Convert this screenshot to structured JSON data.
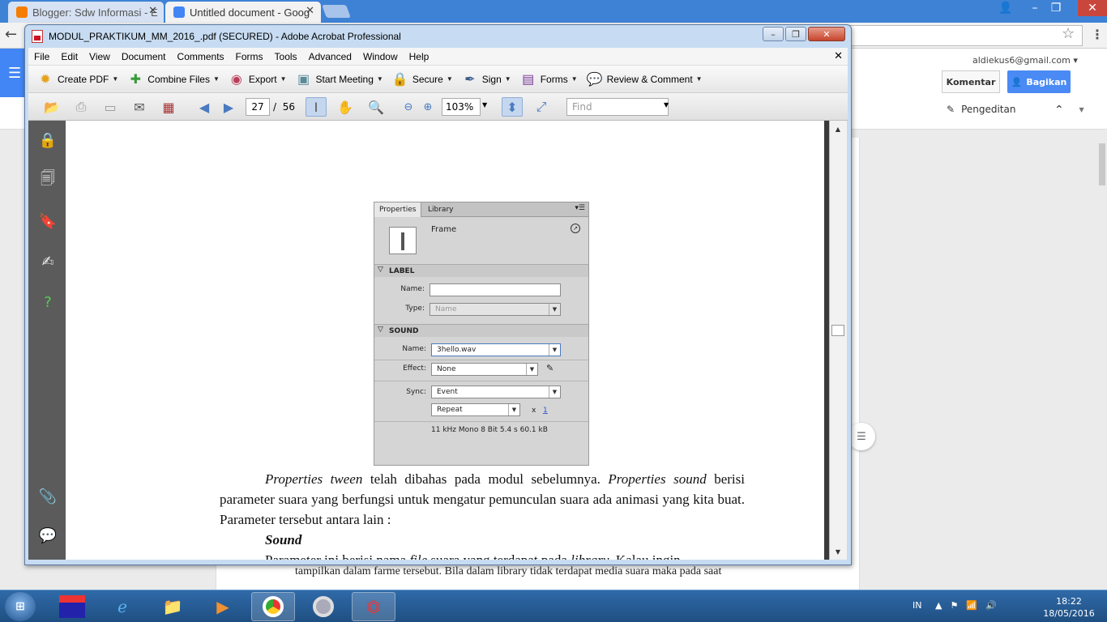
{
  "chrome": {
    "tabs": [
      {
        "title": "Blogger: Sdw Informasi - E",
        "active": false
      },
      {
        "title": "Untitled document - Goog",
        "active": true
      }
    ],
    "window_controls": {
      "minimize": "–",
      "maximize": "❐",
      "close": "✕"
    }
  },
  "docs": {
    "account": "aldiekus6@gmail.com",
    "comment_button": "Komentar",
    "share_button": "Bagikan",
    "mode": "Pengeditan",
    "page_text_line": "tampilkan dalam farme tersebut. Bila dalam library tidak terdapat media suara maka pada saat"
  },
  "acrobat": {
    "title": "MODUL_PRAKTIKUM_MM_2016_.pdf (SECURED) - Adobe Acrobat Professional",
    "menu": [
      "File",
      "Edit",
      "View",
      "Document",
      "Comments",
      "Forms",
      "Tools",
      "Advanced",
      "Window",
      "Help"
    ],
    "tasks": [
      {
        "label": "Create PDF",
        "icon": "create-pdf-icon"
      },
      {
        "label": "Combine Files",
        "icon": "combine-files-icon"
      },
      {
        "label": "Export",
        "icon": "export-icon"
      },
      {
        "label": "Start Meeting",
        "icon": "meeting-icon"
      },
      {
        "label": "Secure",
        "icon": "lock-icon"
      },
      {
        "label": "Sign",
        "icon": "pen-icon"
      },
      {
        "label": "Forms",
        "icon": "forms-icon"
      },
      {
        "label": "Review & Comment",
        "icon": "review-icon"
      }
    ],
    "nav": {
      "current_page": "27",
      "page_separator": "/",
      "total_pages": "56",
      "zoom": "103%",
      "find_placeholder": "Find"
    }
  },
  "panel": {
    "tabs": [
      "Properties",
      "Library"
    ],
    "frame_label": "Frame",
    "label_section": "LABEL",
    "name_label": "Name:",
    "name_value": "",
    "type_label": "Type:",
    "type_value": "Name",
    "sound_section": "SOUND",
    "sound_name_label": "Name:",
    "sound_name_value": "3hello.wav",
    "effect_label": "Effect:",
    "effect_value": "None",
    "sync_label": "Sync:",
    "sync_value": "Event",
    "repeat_value": "Repeat",
    "repeat_x": "x",
    "repeat_count": "1",
    "info": "11 kHz Mono  8 Bit 5.4 s 60.1 kB"
  },
  "body": {
    "p1_it1": "Properties tween",
    "p1_t1": " telah dibahas pada modul sebelumnya. ",
    "p1_it2": "Properties sound",
    "p1_t2": " berisi parameter suara yang berfungsi untuk mengatur pemunculan suara ada animasi yang kita buat. Parameter tersebut antara lain :",
    "heading": "Sound",
    "p2_t1": "Parameter ini berisi nama ",
    "p2_it1": "file",
    "p2_t2": " suara yang terdapat pada ",
    "p2_it2": "library",
    "p2_t3": ". Kalau ingin"
  },
  "taskbar": {
    "lang": "IN",
    "time": "18:22",
    "date": "18/05/2016"
  }
}
